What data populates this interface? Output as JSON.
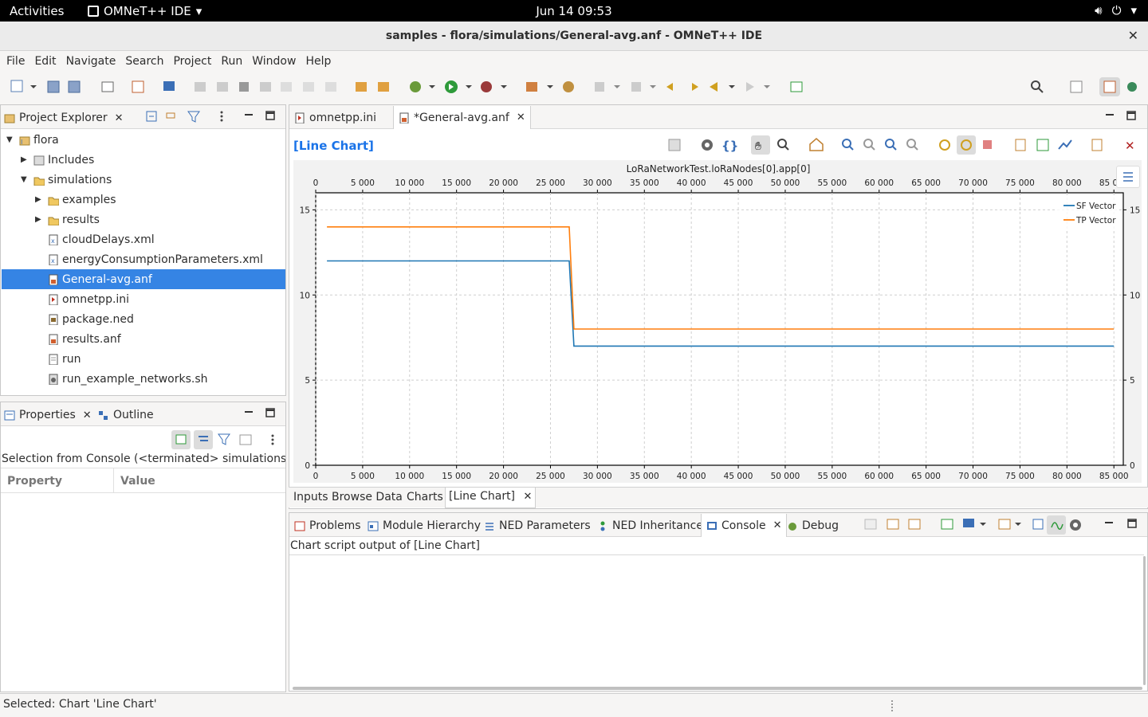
{
  "topbar": {
    "activities": "Activities",
    "app_name": "OMNeT++ IDE",
    "clock": "Jun 14  09:53"
  },
  "window": {
    "title": "samples - flora/simulations/General-avg.anf - OMNeT++ IDE"
  },
  "menu": [
    "File",
    "Edit",
    "Navigate",
    "Search",
    "Project",
    "Run",
    "Window",
    "Help"
  ],
  "project_explorer": {
    "tab_label": "Project Explorer",
    "tree": [
      {
        "label": "flora",
        "icon": "project-icon",
        "expanded": true
      },
      {
        "label": "Includes",
        "icon": "includes-icon",
        "expanded": false
      },
      {
        "label": "simulations",
        "icon": "folder-icon",
        "expanded": true
      },
      {
        "label": "examples",
        "icon": "folder-icon",
        "expanded": false
      },
      {
        "label": "results",
        "icon": "folder-icon",
        "expanded": false
      },
      {
        "label": "cloudDelays.xml",
        "icon": "xml-file-icon"
      },
      {
        "label": "energyConsumptionParameters.xml",
        "icon": "xml-file-icon"
      },
      {
        "label": "General-avg.anf",
        "icon": "anf-file-icon",
        "selected": true
      },
      {
        "label": "omnetpp.ini",
        "icon": "ini-file-icon"
      },
      {
        "label": "package.ned",
        "icon": "ned-file-icon"
      },
      {
        "label": "results.anf",
        "icon": "anf-file-icon"
      },
      {
        "label": "run",
        "icon": "text-file-icon"
      },
      {
        "label": "run_example_networks.sh",
        "icon": "script-file-icon"
      }
    ]
  },
  "properties": {
    "tab_label": "Properties",
    "outline_label": "Outline",
    "selection_text": "Selection from Console (<terminated> simulations [OM",
    "col_property": "Property",
    "col_value": "Value"
  },
  "editor": {
    "tabs": [
      {
        "label": "omnetpp.ini"
      },
      {
        "label": "*General-avg.anf",
        "active": true
      }
    ],
    "chart_header": "[Line Chart]",
    "bottom_tabs": [
      "Inputs",
      "Browse Data",
      "Charts",
      "[Line Chart]"
    ]
  },
  "chart_data": {
    "type": "line",
    "title": "LoRaNetworkTest.loRaNodes[0].app[0]",
    "xlim": [
      0,
      86000
    ],
    "ylim": [
      0,
      16
    ],
    "x_ticks": [
      0,
      5000,
      10000,
      15000,
      20000,
      25000,
      30000,
      35000,
      40000,
      45000,
      50000,
      55000,
      60000,
      65000,
      70000,
      75000,
      80000,
      85000
    ],
    "x_tick_labels": [
      "0",
      "5 000",
      "10 000",
      "15 000",
      "20 000",
      "25 000",
      "30 000",
      "35 000",
      "40 000",
      "45 000",
      "50 000",
      "55 000",
      "60 000",
      "65 000",
      "70 000",
      "75 000",
      "80 000",
      "85 000"
    ],
    "y_ticks": [
      0,
      5,
      10,
      15
    ],
    "grid": true,
    "legend": "top-right",
    "series": [
      {
        "name": "SF Vector",
        "color": "#1f77b4",
        "x": [
          1200,
          27000,
          27500,
          85000
        ],
        "y": [
          12,
          12,
          7,
          7
        ]
      },
      {
        "name": "TP Vector",
        "color": "#ff7f0e",
        "x": [
          1200,
          27000,
          27500,
          85000
        ],
        "y": [
          14,
          14,
          8,
          8
        ]
      }
    ]
  },
  "console": {
    "tabs": [
      "Problems",
      "Module Hierarchy",
      "NED Parameters",
      "NED Inheritance",
      "Console",
      "Debug"
    ],
    "header": "Chart script output of [Line Chart]"
  },
  "status": {
    "text": "Selected: Chart 'Line Chart'"
  }
}
